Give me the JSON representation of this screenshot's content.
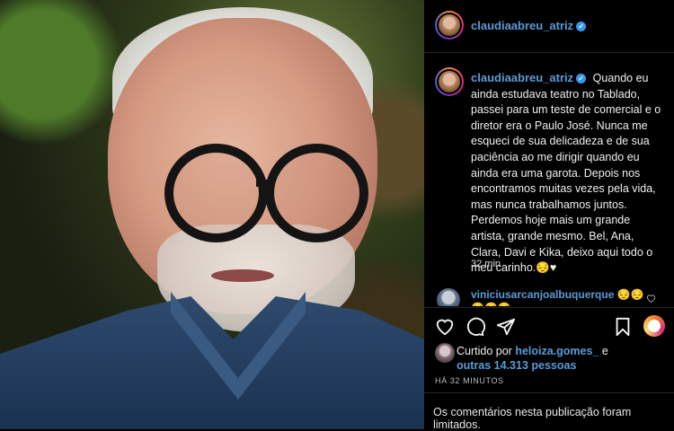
{
  "post": {
    "username": "claudiaabreu_atriz",
    "verified_mark": "✓",
    "more_label": "•••",
    "caption": "Quando eu ainda estudava teatro no Tablado, passei para um teste de comercial e o diretor era o Paulo José. Nunca me esqueci de sua delicadeza e de sua paciência ao me dirigir quando eu ainda era uma garota. Depois nos encontramos muitas vezes pela vida, mas nunca trabalhamos juntos. Perdemos hoje mais um grande artista, grande mesmo. Bel, Ana, Clara, Davi e Kika, deixo aqui todo o meu carinho.😔♥",
    "caption_time": "32 min",
    "comment": {
      "username": "viniciusarcanjoalbuquerque",
      "text": " 😔😔",
      "second_line": "😔😔😔"
    },
    "liked_by": {
      "prefix": "Curtido por ",
      "user": "heloiza.gomes_",
      "joiner": " e",
      "others": "outras 14.313 pessoas"
    },
    "posted_ago": "HÁ 32 MINUTOS",
    "comments_limited": "Os comentários nesta publicação foram limitados."
  },
  "icons": {
    "like": "heart-outline-icon",
    "comment": "comment-bubble-icon",
    "share": "paper-plane-icon",
    "save": "bookmark-icon",
    "comment_like": "small-heart-icon",
    "story": "story-ring-icon"
  },
  "colors": {
    "username": "#5a9bd8",
    "verified": "#3897f0",
    "background": "#000000"
  }
}
